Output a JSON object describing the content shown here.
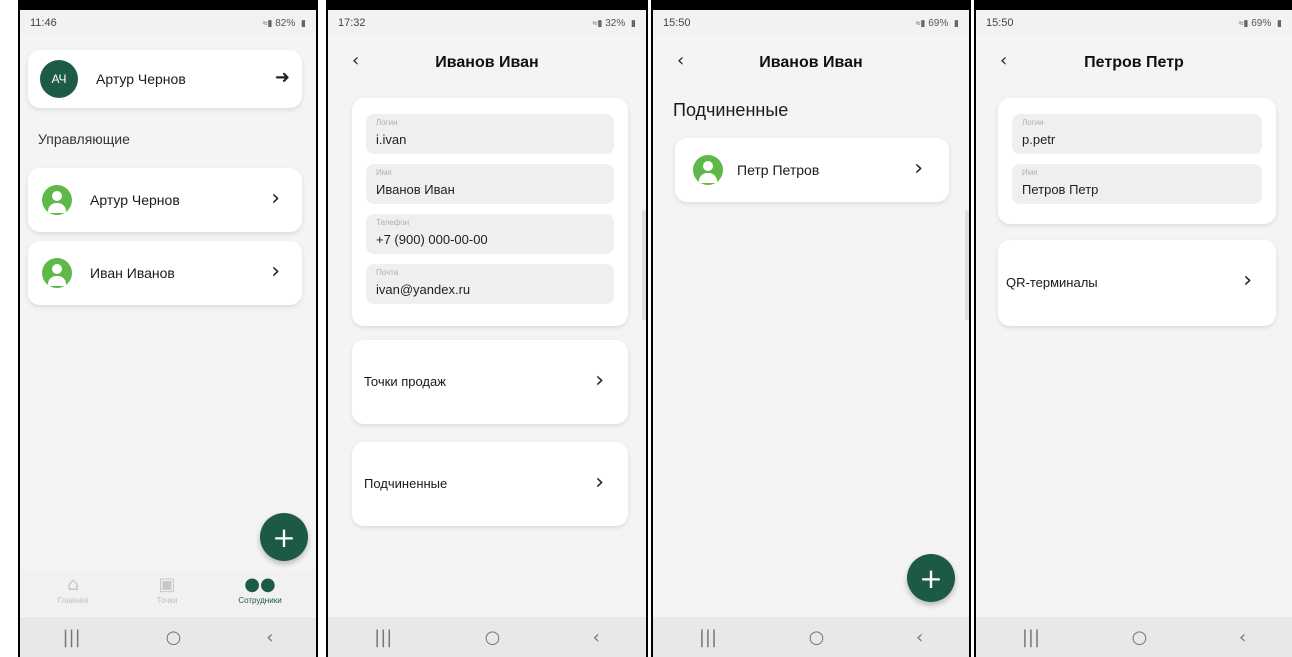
{
  "screens": [
    {
      "status": {
        "time": "11:46",
        "right": "82%"
      },
      "user_card": {
        "initials": "АЧ",
        "name": "Артур Чернов"
      },
      "section_label": "Управляющие",
      "items": [
        {
          "name": "Артур Чернов"
        },
        {
          "name": "Иван Иванов"
        }
      ],
      "nav": [
        {
          "label": "Главная",
          "icon": "home-icon"
        },
        {
          "label": "Точки",
          "icon": "briefcase-icon"
        },
        {
          "label": "Сотрудники",
          "icon": "people-icon"
        }
      ]
    },
    {
      "status": {
        "time": "17:32",
        "right": "32%"
      },
      "title": "Иванов Иван",
      "fields": [
        {
          "label": "Логин",
          "value": "i.ivan"
        },
        {
          "label": "Имя",
          "value": "Иванов Иван"
        },
        {
          "label": "Телефон",
          "value": "+7 (900) 000-00-00"
        },
        {
          "label": "Почта",
          "value": "ivan@yandex.ru"
        }
      ],
      "links": [
        {
          "label": "Точки продаж"
        },
        {
          "label": "Подчиненные"
        }
      ]
    },
    {
      "status": {
        "time": "15:50",
        "right": "69%"
      },
      "title": "Иванов Иван",
      "section_label": "Подчиненные",
      "items": [
        {
          "name": "Петр Петров"
        }
      ]
    },
    {
      "status": {
        "time": "15:50",
        "right": "69%"
      },
      "title": "Петров Петр",
      "fields": [
        {
          "label": "Логин",
          "value": "p.petr"
        },
        {
          "label": "Имя",
          "value": "Петров Петр"
        }
      ],
      "links": [
        {
          "label": "QR-терминалы"
        }
      ]
    }
  ]
}
